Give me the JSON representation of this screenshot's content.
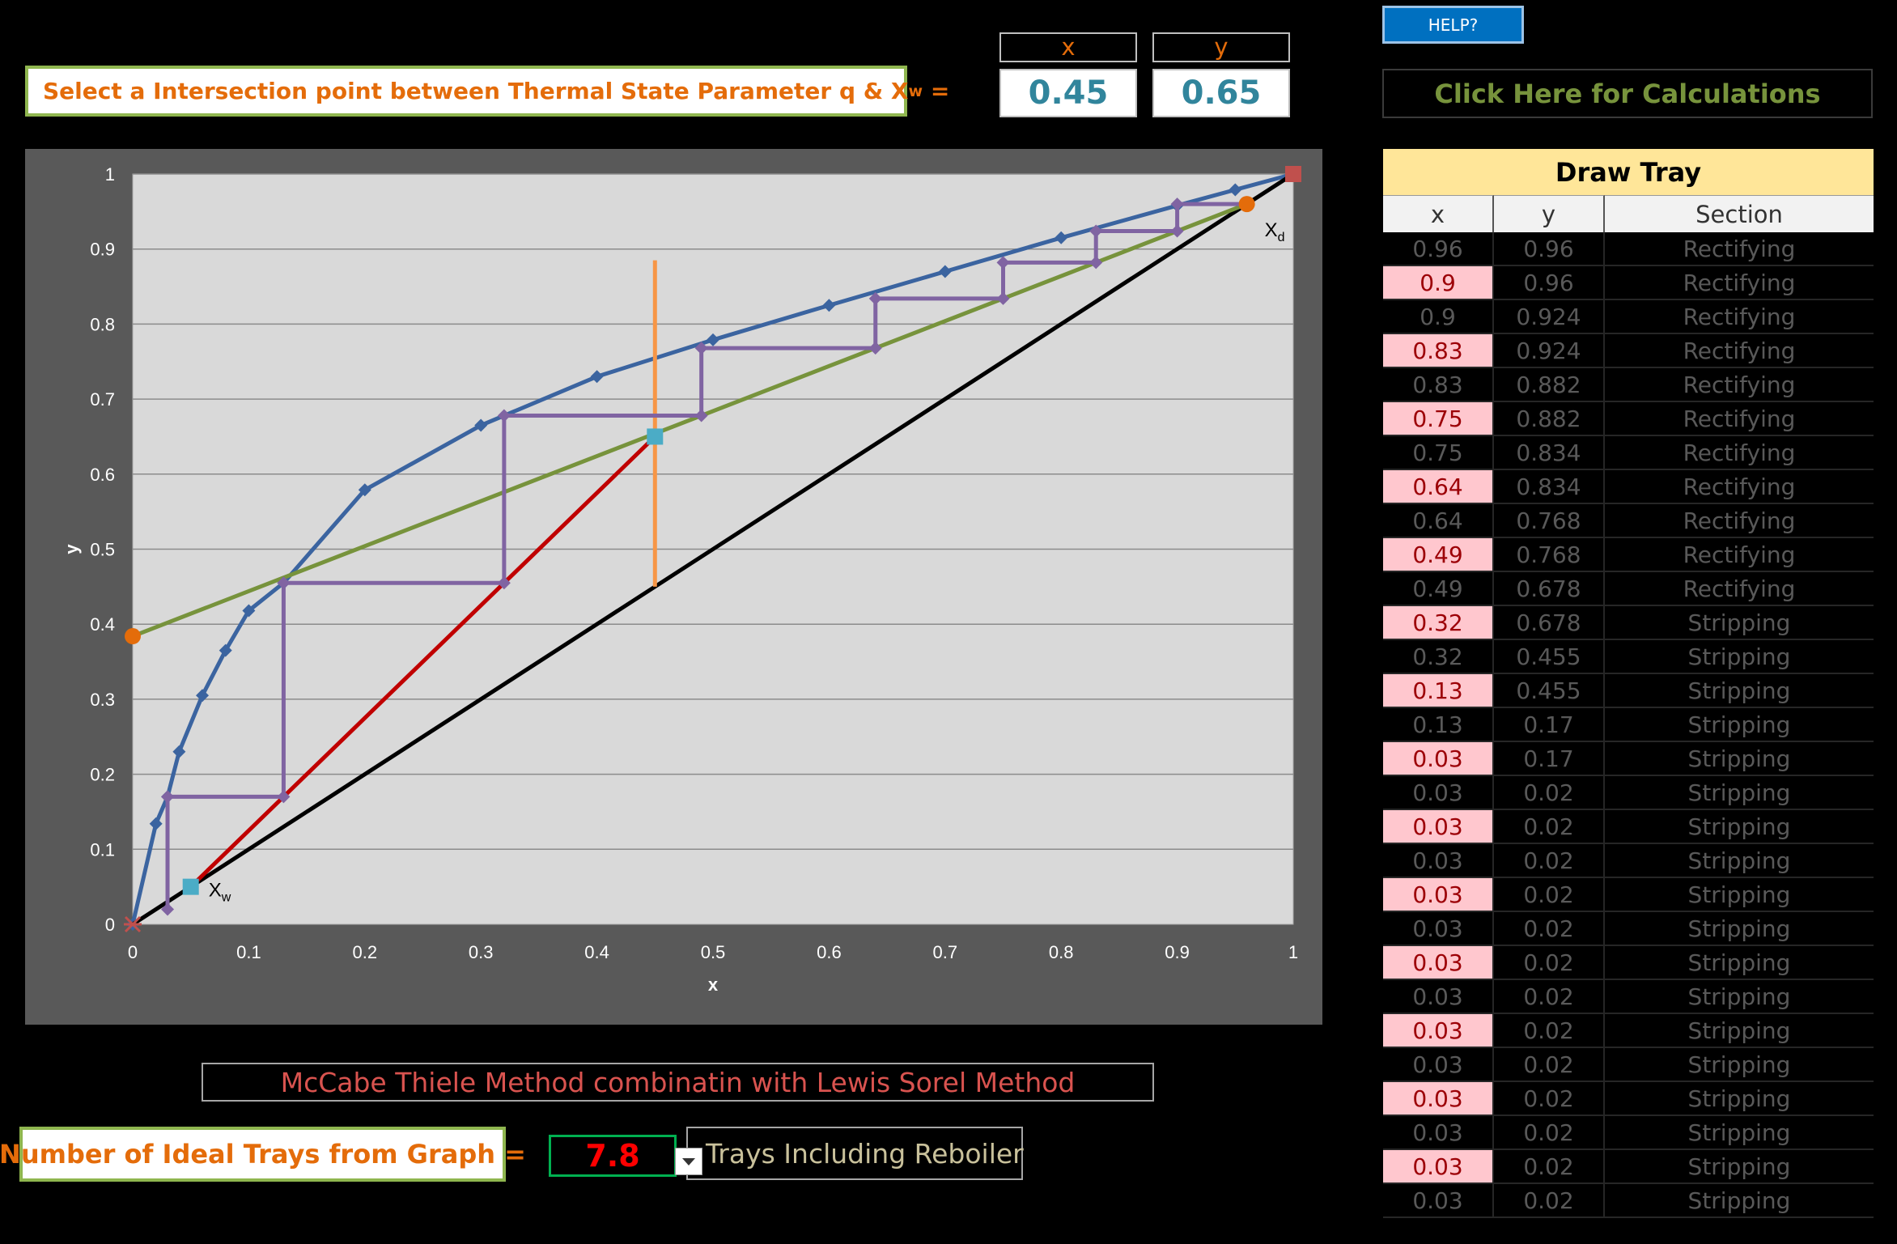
{
  "prompt": {
    "main": "Select a Intersection point between Thermal State Parameter q &  X",
    "sub": "w",
    "tail": " ="
  },
  "intersection": {
    "x_header": "x",
    "y_header": "y",
    "x_value": "0.45",
    "y_value": "0.65"
  },
  "buttons": {
    "help": "HELP?",
    "calculations": "Click Here for Calculations"
  },
  "method_label": "McCabe Thiele Method combinatin with Lewis Sorel Method",
  "trays": {
    "label": "Number of Ideal Trays from Graph =",
    "value": "7.8",
    "suffix": "Trays Including Reboiler"
  },
  "draw_tray": {
    "title": "Draw Tray",
    "columns": [
      "x",
      "y",
      "Section"
    ],
    "rows": [
      [
        "0.96",
        "0.96",
        "Rectifying"
      ],
      [
        "0.9",
        "0.96",
        "Rectifying"
      ],
      [
        "0.9",
        "0.924",
        "Rectifying"
      ],
      [
        "0.83",
        "0.924",
        "Rectifying"
      ],
      [
        "0.83",
        "0.882",
        "Rectifying"
      ],
      [
        "0.75",
        "0.882",
        "Rectifying"
      ],
      [
        "0.75",
        "0.834",
        "Rectifying"
      ],
      [
        "0.64",
        "0.834",
        "Rectifying"
      ],
      [
        "0.64",
        "0.768",
        "Rectifying"
      ],
      [
        "0.49",
        "0.768",
        "Rectifying"
      ],
      [
        "0.49",
        "0.678",
        "Rectifying"
      ],
      [
        "0.32",
        "0.678",
        "Stripping"
      ],
      [
        "0.32",
        "0.455",
        "Stripping"
      ],
      [
        "0.13",
        "0.455",
        "Stripping"
      ],
      [
        "0.13",
        "0.17",
        "Stripping"
      ],
      [
        "0.03",
        "0.17",
        "Stripping"
      ],
      [
        "0.03",
        "0.02",
        "Stripping"
      ],
      [
        "0.03",
        "0.02",
        "Stripping"
      ],
      [
        "0.03",
        "0.02",
        "Stripping"
      ],
      [
        "0.03",
        "0.02",
        "Stripping"
      ],
      [
        "0.03",
        "0.02",
        "Stripping"
      ],
      [
        "0.03",
        "0.02",
        "Stripping"
      ],
      [
        "0.03",
        "0.02",
        "Stripping"
      ],
      [
        "0.03",
        "0.02",
        "Stripping"
      ],
      [
        "0.03",
        "0.02",
        "Stripping"
      ],
      [
        "0.03",
        "0.02",
        "Stripping"
      ],
      [
        "0.03",
        "0.02",
        "Stripping"
      ],
      [
        "0.03",
        "0.02",
        "Stripping"
      ],
      [
        "0.03",
        "0.02",
        "Stripping"
      ]
    ]
  },
  "chart_data": {
    "type": "line",
    "xlabel": "x",
    "ylabel": "y",
    "xlim": [
      0,
      1
    ],
    "ylim": [
      0,
      1
    ],
    "xticks": [
      "0",
      "0.1",
      "0.2",
      "0.3",
      "0.4",
      "0.5",
      "0.6",
      "0.7",
      "0.8",
      "0.9",
      "1"
    ],
    "yticks": [
      "0",
      "0.1",
      "0.2",
      "0.3",
      "0.4",
      "0.5",
      "0.6",
      "0.7",
      "0.8",
      "0.9",
      "1"
    ],
    "grid": "horizontal",
    "annotations": [
      {
        "main": "X",
        "sub": "w",
        "x": 0.05,
        "y": 0.05
      },
      {
        "main": "X",
        "sub": "d",
        "x": 0.96,
        "y": 0.96
      }
    ],
    "series": [
      {
        "color": "#3b64a0",
        "marker": "diamond",
        "x": [
          0,
          0.02,
          0.03,
          0.04,
          0.06,
          0.08,
          0.1,
          0.13,
          0.2,
          0.3,
          0.4,
          0.5,
          0.6,
          0.7,
          0.8,
          0.9,
          0.95,
          1.0
        ],
        "y": [
          0,
          0.134,
          0.17,
          0.23,
          0.305,
          0.365,
          0.418,
          0.455,
          0.579,
          0.665,
          0.73,
          0.779,
          0.825,
          0.87,
          0.915,
          0.958,
          0.979,
          1.0
        ]
      },
      {
        "color": "#000000",
        "x": [
          0,
          1
        ],
        "y": [
          0,
          1
        ]
      },
      {
        "color": "#77933c",
        "x": [
          0,
          0.96
        ],
        "y": [
          0.384,
          0.96
        ]
      },
      {
        "color": "#c00000",
        "x": [
          0.05,
          0.45
        ],
        "y": [
          0.05,
          0.65
        ]
      },
      {
        "color": "#f79646",
        "x": [
          0.45,
          0.45
        ],
        "y": [
          0.45,
          0.885
        ]
      },
      {
        "color": "#8064a2",
        "marker": "diamond",
        "x": [
          0.96,
          0.9,
          0.9,
          0.83,
          0.83,
          0.75,
          0.75,
          0.64,
          0.64,
          0.49,
          0.49,
          0.32,
          0.32,
          0.13,
          0.13,
          0.03,
          0.03
        ],
        "y": [
          0.96,
          0.96,
          0.924,
          0.924,
          0.882,
          0.882,
          0.834,
          0.834,
          0.768,
          0.768,
          0.678,
          0.678,
          0.455,
          0.455,
          0.17,
          0.17,
          0.02
        ]
      }
    ],
    "points": [
      {
        "color": "#4bacc6",
        "marker": "square",
        "x": 0.05,
        "y": 0.05
      },
      {
        "color": "#4bacc6",
        "marker": "square",
        "x": 0.45,
        "y": 0.65
      },
      {
        "color": "#e46c0a",
        "marker": "circle",
        "x": 0,
        "y": 0.384
      },
      {
        "color": "#e46c0a",
        "marker": "circle",
        "x": 0.96,
        "y": 0.96
      },
      {
        "color": "#c0504d",
        "marker": "square",
        "x": 1.0,
        "y": 1.0
      },
      {
        "color": "#c0504d",
        "marker": "star",
        "x": 0,
        "y": 0
      }
    ]
  }
}
